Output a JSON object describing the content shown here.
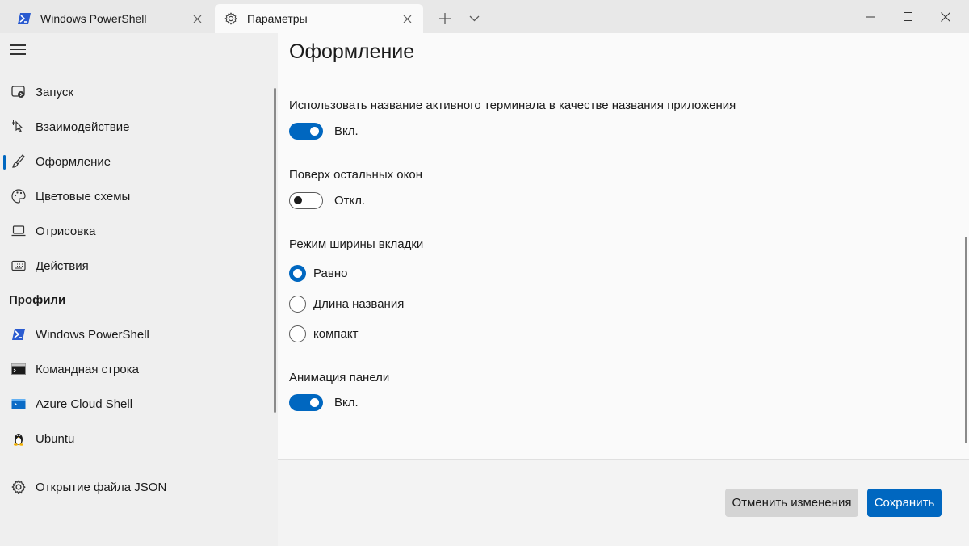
{
  "titlebar": {
    "tabs": [
      {
        "label": "Windows PowerShell",
        "icon": "powershell-icon"
      },
      {
        "label": "Параметры",
        "icon": "gear-icon"
      }
    ],
    "new_tab": "+"
  },
  "sidebar": {
    "items": [
      {
        "label": "Запуск",
        "icon": "startup-icon"
      },
      {
        "label": "Взаимодействие",
        "icon": "interaction-icon"
      },
      {
        "label": "Оформление",
        "icon": "brush-icon"
      },
      {
        "label": "Цветовые схемы",
        "icon": "palette-icon"
      },
      {
        "label": "Отрисовка",
        "icon": "laptop-icon"
      },
      {
        "label": "Действия",
        "icon": "keyboard-icon"
      }
    ],
    "profiles_header": "Профили",
    "profiles": [
      {
        "label": "Windows PowerShell",
        "icon": "powershell-icon"
      },
      {
        "label": "Командная строка",
        "icon": "cmd-icon"
      },
      {
        "label": "Azure Cloud Shell",
        "icon": "azure-icon"
      },
      {
        "label": "Ubuntu",
        "icon": "linux-icon"
      }
    ],
    "open_json": {
      "label": "Открытие файла JSON",
      "icon": "gear-icon"
    }
  },
  "main": {
    "title": "Оформление",
    "settings": {
      "use_active_title": {
        "label": "Использовать название активного терминала в качестве названия приложения",
        "state": "Вкл."
      },
      "always_on_top": {
        "label": "Поверх остальных окон",
        "state": "Откл."
      },
      "tab_width_mode": {
        "label": "Режим ширины вкладки",
        "options": [
          "Равно",
          "Длина названия",
          "компакт"
        ],
        "selected": "Равно"
      },
      "pane_animation": {
        "label": "Анимация панели",
        "state": "Вкл."
      }
    },
    "footer": {
      "discard_label": "Отменить изменения",
      "save_label": "Сохранить"
    }
  },
  "colors": {
    "accent": "#0067c0",
    "sidebar_bg": "#efefef",
    "titlebar_bg": "#e8e8e8"
  }
}
